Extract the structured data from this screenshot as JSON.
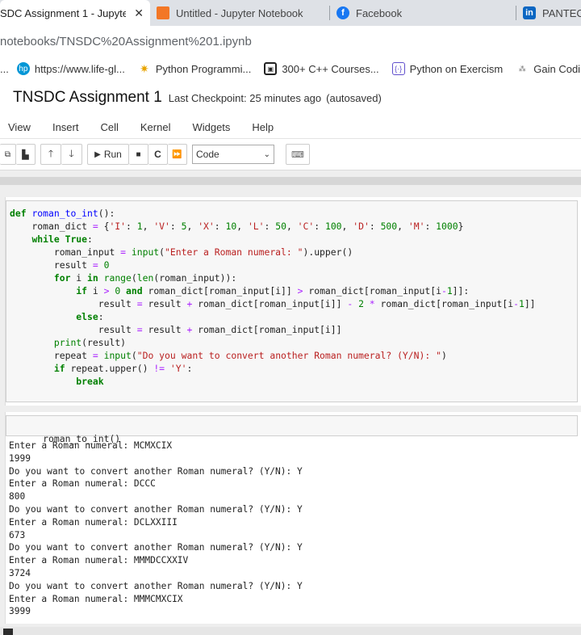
{
  "browser": {
    "tabs": [
      {
        "label": "SDC Assignment 1 - Jupyte",
        "icon": "jupyter-icon",
        "close": "✕"
      },
      {
        "label": "Untitled - Jupyter Notebook",
        "icon": "jupyter-icon"
      },
      {
        "label": "Facebook",
        "icon": "facebook-icon"
      },
      {
        "label": "PANTECH",
        "icon": "linkedin-icon"
      }
    ],
    "address": "notebooks/TNSDC%20Assignment%201.ipynb",
    "bookmarks": [
      {
        "label": "...",
        "icon": ""
      },
      {
        "label": "https://www.life-gl...",
        "icon": "hp-icon"
      },
      {
        "label": "Python Programmi...",
        "icon": "python-icon"
      },
      {
        "label": "300+ C++ Courses...",
        "icon": "course-icon"
      },
      {
        "label": "Python on Exercism",
        "icon": "exercism-icon"
      },
      {
        "label": "Gain Codi",
        "icon": "gain-icon"
      }
    ],
    "colors": {
      "tabstrip": "#dee1e6",
      "facebook": "#1877f2",
      "linkedin": "#0a66c2",
      "jupyter": "#f37726"
    }
  },
  "notebook": {
    "title": "TNSDC Assignment 1",
    "checkpoint": "Last Checkpoint: 25 minutes ago",
    "autosaved": "(autosaved)",
    "menu": [
      "View",
      "Insert",
      "Cell",
      "Kernel",
      "Widgets",
      "Help"
    ],
    "toolbar": {
      "run_label": "Run",
      "cell_type": "Code"
    },
    "code_cell": [
      "def roman_to_int():",
      "    roman_dict = {'I': 1, 'V': 5, 'X': 10, 'L': 50, 'C': 100, 'D': 500, 'M': 1000}",
      "    while True:",
      "        roman_input = input(\"Enter a Roman numeral: \").upper()",
      "        result = 0",
      "        for i in range(len(roman_input)):",
      "            if i > 0 and roman_dict[roman_input[i]] > roman_dict[roman_input[i-1]]:",
      "                result = result + roman_dict[roman_input[i]] - 2 * roman_dict[roman_input[i-1]]",
      "            else:",
      "                result = result + roman_dict[roman_input[i]]",
      "        print(result)",
      "        repeat = input(\"Do you want to convert another Roman numeral? (Y/N): \")",
      "        if repeat.upper() != 'Y':",
      "            break"
    ],
    "call_cell": "roman_to_int()",
    "output_lines": [
      "Enter a Roman numeral: MCMXCIX",
      "1999",
      "Do you want to convert another Roman numeral? (Y/N): Y",
      "Enter a Roman numeral: DCCC",
      "800",
      "Do you want to convert another Roman numeral? (Y/N): Y",
      "Enter a Roman numeral: DCLXXIII",
      "673",
      "Do you want to convert another Roman numeral? (Y/N): Y",
      "Enter a Roman numeral: MMMDCCXXIV",
      "3724",
      "Do you want to convert another Roman numeral? (Y/N): Y",
      "Enter a Roman numeral: MMMCMXCIX",
      "3999"
    ]
  }
}
